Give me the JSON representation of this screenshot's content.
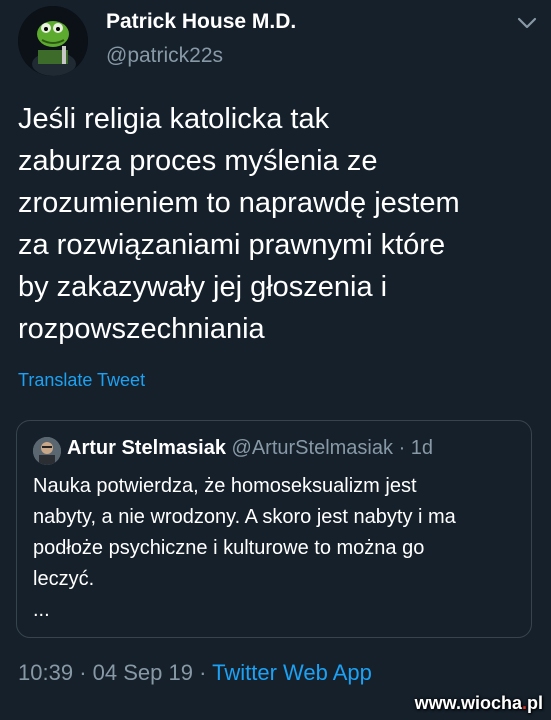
{
  "author": {
    "name": "Patrick House M.D.",
    "handle": "@patrick22s"
  },
  "tweet": {
    "lines": [
      "Jeśli religia katolicka tak",
      "zaburza proces myślenia ze",
      "zrozumieniem to naprawdę jestem",
      "za rozwiązaniami prawnymi które",
      "by zakazywały jej głoszenia i",
      "rozpowszechniania"
    ],
    "translate_label": "Translate Tweet"
  },
  "quoted": {
    "name": "Artur Stelmasiak",
    "handle": "@ArturStelmasiak",
    "time": "· 1d",
    "lines": [
      "Nauka potwierdza, że homoseksualizm jest",
      "nabyty, a nie wrodzony. A skoro jest nabyty i ma",
      "podłoże psychiczne i kulturowe to można go",
      "leczyć.",
      "..."
    ]
  },
  "meta": {
    "time": "10:39",
    "sep1": "·",
    "date": "04 Sep 19",
    "sep2": "·",
    "source": "Twitter Web App"
  },
  "watermark": {
    "part1": "www.wiocha",
    "dot": ".",
    "part2": "pl"
  },
  "icons": {
    "chevron": "chevron-down-icon"
  },
  "colors": {
    "background": "#15202b",
    "accent": "#1da1f2",
    "secondary_text": "#8899a6",
    "border": "#38444d"
  }
}
